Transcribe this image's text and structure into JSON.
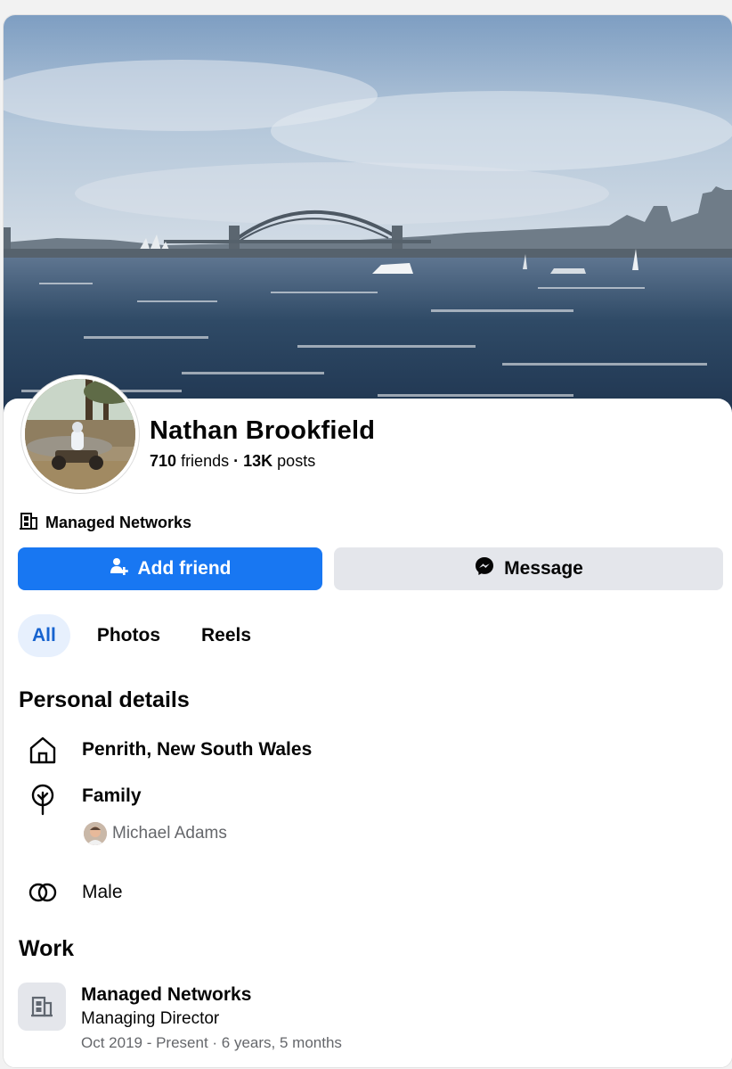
{
  "profile": {
    "name": "Nathan Brookfield",
    "friends_count": "710",
    "friends_label": "friends",
    "separator": "·",
    "posts_count": "13K",
    "posts_label": "posts",
    "workplace": "Managed Networks"
  },
  "actions": {
    "add_friend": "Add friend",
    "message": "Message"
  },
  "tabs": [
    {
      "label": "All",
      "active": true
    },
    {
      "label": "Photos",
      "active": false
    },
    {
      "label": "Reels",
      "active": false
    }
  ],
  "personal_details": {
    "title": "Personal details",
    "location": "Penrith, New South Wales",
    "family_label": "Family",
    "family_member": "Michael Adams",
    "gender": "Male"
  },
  "work": {
    "title": "Work",
    "company": "Managed Networks",
    "role": "Managing Director",
    "dates": "Oct 2019 - Present · 6 years, 5 months"
  },
  "colors": {
    "accent": "#1877f2",
    "accent_text": "#1763cf",
    "secondary_button": "#e4e6eb",
    "muted_text": "#65676b"
  },
  "icons": {
    "add_friend": "person-plus-icon",
    "message": "messenger-icon",
    "workplace": "building-icon",
    "location": "home-icon",
    "family": "family-tree-icon",
    "gender": "gender-rings-icon"
  }
}
